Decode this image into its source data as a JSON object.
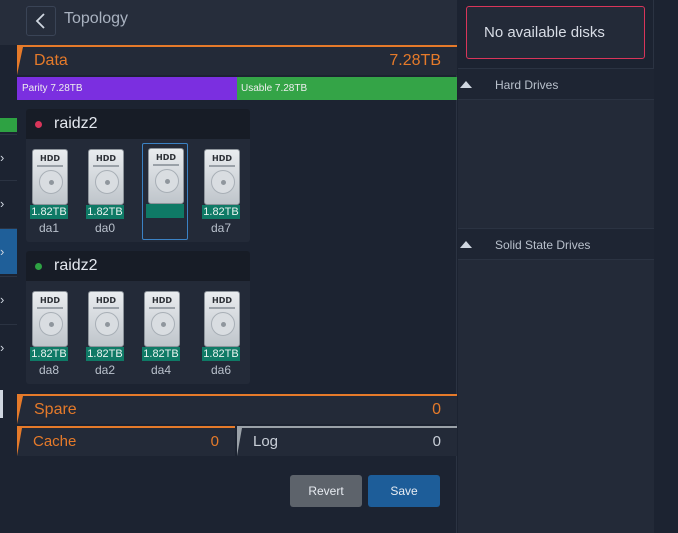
{
  "header": {
    "title": "Topology"
  },
  "data_vdev": {
    "label": "Data",
    "size": "7.28TB",
    "parity_label": "Parity 7.28TB",
    "usable_label": "Usable 7.28TB",
    "parity_color": "#7b2fe0",
    "usable_color": "#34a447"
  },
  "groups": [
    {
      "name": "raidz2",
      "status_color": "#d9355a",
      "disks": [
        {
          "size": "1.82TB",
          "name": "da1"
        },
        {
          "size": "1.82TB",
          "name": "da0"
        },
        {
          "size": "",
          "name": ""
        },
        {
          "size": "1.82TB",
          "name": "da7"
        }
      ]
    },
    {
      "name": "raidz2",
      "status_color": "#2ea243",
      "disks": [
        {
          "size": "1.82TB",
          "name": "da8"
        },
        {
          "size": "1.82TB",
          "name": "da2"
        },
        {
          "size": "1.82TB",
          "name": "da4"
        },
        {
          "size": "1.82TB",
          "name": "da6"
        }
      ]
    }
  ],
  "disk_icon_label": "HDD",
  "spare": {
    "label": "Spare",
    "value": "0"
  },
  "cache": {
    "label": "Cache",
    "value": "0"
  },
  "log": {
    "label": "Log",
    "value": "0"
  },
  "buttons": {
    "revert": "Revert",
    "save": "Save"
  },
  "available": {
    "message": "No available disks",
    "sections": [
      {
        "label": "Hard Drives"
      },
      {
        "label": "Solid State Drives"
      }
    ]
  },
  "colors": {
    "accent": "#e57a2a",
    "primary": "#1d5d99",
    "background": "#1c2331"
  }
}
